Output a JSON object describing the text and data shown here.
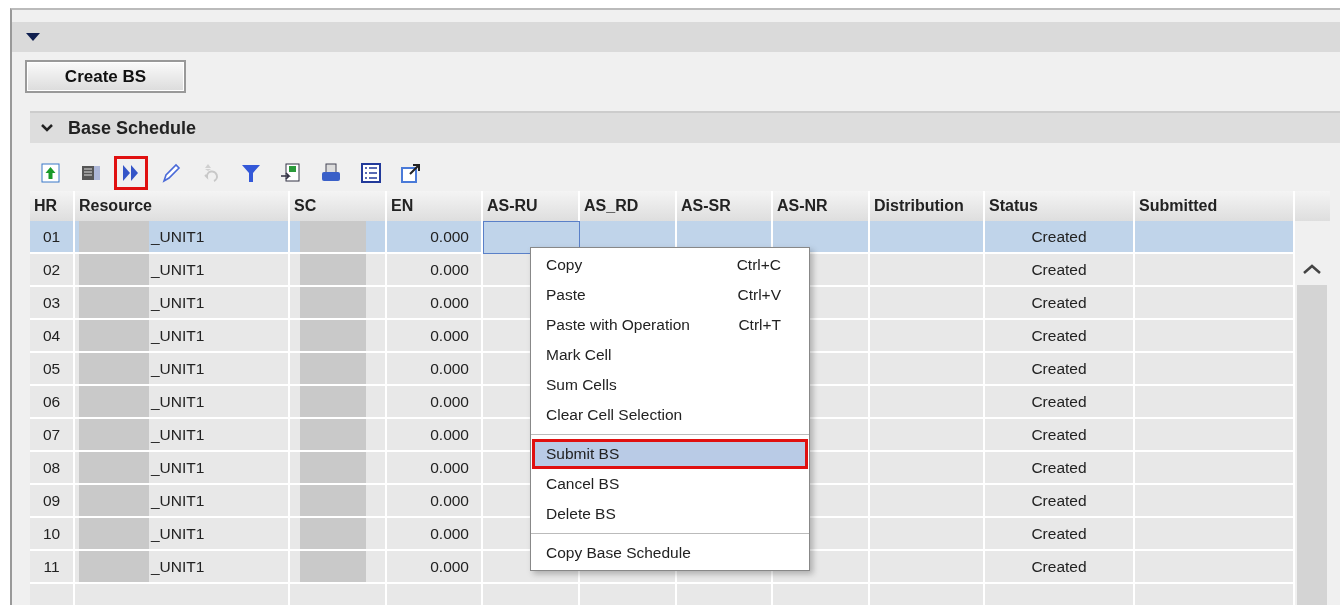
{
  "create_button": {
    "label": "Create BS"
  },
  "panel": {
    "title": "Base Schedule",
    "expanded": true
  },
  "toolbar": [
    {
      "kind": "upload",
      "highlighted": false,
      "disabled": false
    },
    {
      "kind": "columns",
      "highlighted": false,
      "disabled": false
    },
    {
      "kind": "submit",
      "highlighted": true,
      "disabled": false
    },
    {
      "kind": "edit",
      "highlighted": false,
      "disabled": false
    },
    {
      "kind": "undo",
      "highlighted": false,
      "disabled": true
    },
    {
      "kind": "filter",
      "highlighted": false,
      "disabled": false
    },
    {
      "kind": "export",
      "highlighted": false,
      "disabled": false
    },
    {
      "kind": "print",
      "highlighted": false,
      "disabled": false
    },
    {
      "kind": "checklist",
      "highlighted": false,
      "disabled": false
    },
    {
      "kind": "popout",
      "highlighted": false,
      "disabled": false
    }
  ],
  "table": {
    "columns": [
      "HR",
      "Resource",
      "SC",
      "EN",
      "AS-RU",
      "AS_RD",
      "AS-SR",
      "AS-NR",
      "Distribution",
      "Status",
      "Submitted"
    ],
    "rows": [
      {
        "hr": "01",
        "resource": "_UNIT1",
        "en": "0.000",
        "status": "Created",
        "selected": true
      },
      {
        "hr": "02",
        "resource": "_UNIT1",
        "en": "0.000",
        "status": "Created",
        "selected": false
      },
      {
        "hr": "03",
        "resource": "_UNIT1",
        "en": "0.000",
        "status": "Created",
        "selected": false
      },
      {
        "hr": "04",
        "resource": "_UNIT1",
        "en": "0.000",
        "status": "Created",
        "selected": false
      },
      {
        "hr": "05",
        "resource": "_UNIT1",
        "en": "0.000",
        "status": "Created",
        "selected": false
      },
      {
        "hr": "06",
        "resource": "_UNIT1",
        "en": "0.000",
        "status": "Created",
        "selected": false
      },
      {
        "hr": "07",
        "resource": "_UNIT1",
        "en": "0.000",
        "status": "Created",
        "selected": false
      },
      {
        "hr": "08",
        "resource": "_UNIT1",
        "en": "0.000",
        "status": "Created",
        "selected": false
      },
      {
        "hr": "09",
        "resource": "_UNIT1",
        "en": "0.000",
        "status": "Created",
        "selected": false
      },
      {
        "hr": "10",
        "resource": "_UNIT1",
        "en": "0.000",
        "status": "Created",
        "selected": false
      },
      {
        "hr": "11",
        "resource": "_UNIT1",
        "en": "0.000",
        "status": "Created",
        "selected": false
      }
    ]
  },
  "context_menu": [
    {
      "kind": "item",
      "label": "Copy",
      "shortcut": "Ctrl+C",
      "selected": false
    },
    {
      "kind": "item",
      "label": "Paste",
      "shortcut": "Ctrl+V",
      "selected": false
    },
    {
      "kind": "item",
      "label": "Paste with Operation",
      "shortcut": "Ctrl+T",
      "selected": false
    },
    {
      "kind": "item",
      "label": "Mark Cell",
      "selected": false
    },
    {
      "kind": "item",
      "label": "Sum Cells",
      "selected": false
    },
    {
      "kind": "item",
      "label": "Clear Cell Selection",
      "selected": false
    },
    {
      "kind": "separator"
    },
    {
      "kind": "item",
      "label": "Submit BS",
      "selected": true
    },
    {
      "kind": "item",
      "label": "Cancel BS",
      "selected": false
    },
    {
      "kind": "item",
      "label": "Delete BS",
      "selected": false
    },
    {
      "kind": "separator"
    },
    {
      "kind": "item",
      "label": "Copy Base Schedule",
      "selected": false
    }
  ]
}
